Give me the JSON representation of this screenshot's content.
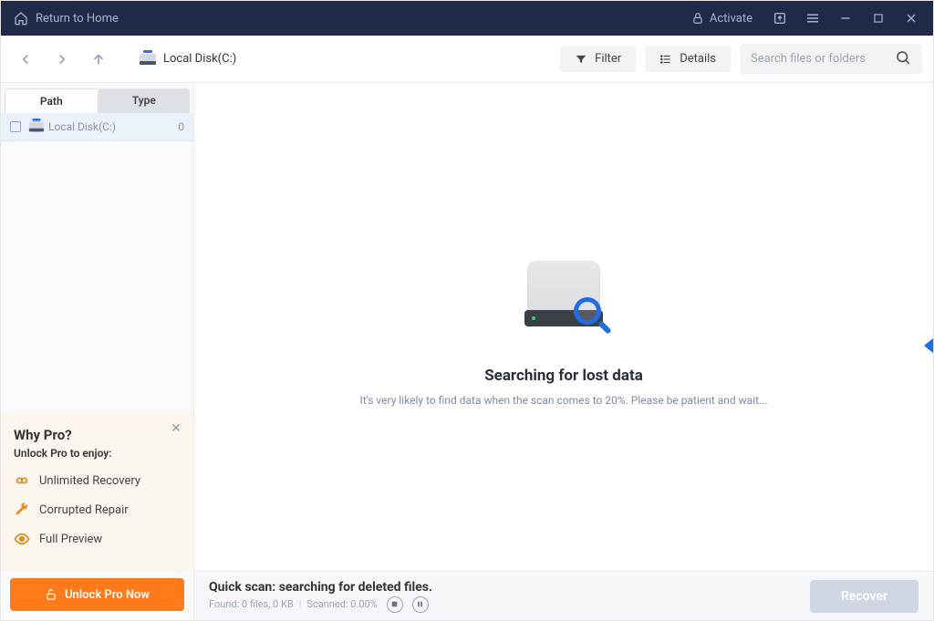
{
  "titlebar": {
    "return_home": "Return to Home",
    "activate": "Activate"
  },
  "toolbar": {
    "location": "Local Disk(C:)",
    "filter": "Filter",
    "details": "Details",
    "search_placeholder": "Search files or folders"
  },
  "sidebar": {
    "tabs": {
      "path": "Path",
      "type": "Type"
    },
    "tree": [
      {
        "label": "Local Disk(C:)",
        "count": "0"
      }
    ]
  },
  "pro": {
    "title": "Why Pro?",
    "subtitle": "Unlock Pro to enjoy:",
    "features": [
      "Unlimited Recovery",
      "Corrupted Repair",
      "Full Preview"
    ],
    "unlock": "Unlock Pro Now"
  },
  "content": {
    "title": "Searching for lost data",
    "subtitle": "It's very likely to find data when the scan comes to 20%. Please be patient and wait..."
  },
  "footer": {
    "title": "Quick scan: searching for deleted files.",
    "found": "Found: 0 files, 0 KB",
    "scanned": "Scanned: 0.00%",
    "recover": "Recover"
  }
}
